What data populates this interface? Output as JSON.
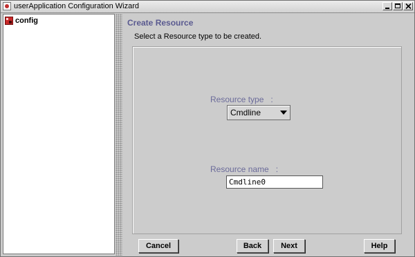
{
  "window": {
    "title": "userApplication Configuration Wizard",
    "controls": [
      "minimize-icon",
      "maximize-icon",
      "close-icon"
    ]
  },
  "tree": {
    "items": [
      {
        "label": "config",
        "icon": "config-node-icon"
      }
    ]
  },
  "main": {
    "heading": "Create Resource",
    "instruction": "Select a Resource type to be created.",
    "resource_type": {
      "label": "Resource type",
      "separator": ":",
      "selected": "Cmdline"
    },
    "resource_name": {
      "label": "Resource name",
      "separator": ":",
      "value": "Cmdline0"
    }
  },
  "buttons": {
    "cancel": "Cancel",
    "back": "Back",
    "next": "Next",
    "help": "Help"
  },
  "colors": {
    "heading": "#5a5a90",
    "field_label": "#6b6b9a",
    "background": "#cccccc"
  }
}
